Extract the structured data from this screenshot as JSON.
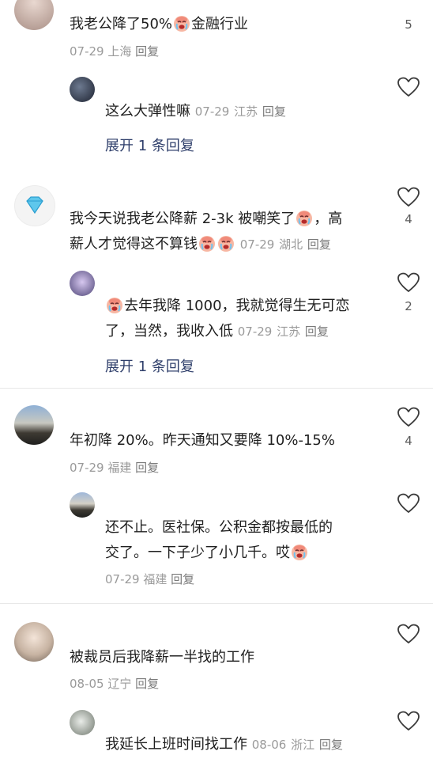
{
  "comments": [
    {
      "text": "我老公降了50%",
      "text_after_emoji": "金融行业",
      "date": "07-29",
      "location": "上海",
      "reply_label": "回复",
      "likes": "5",
      "reply": {
        "text": "这么大弹性嘛",
        "date": "07-29",
        "location": "江苏",
        "reply_label": "回复"
      },
      "expand_label": "展开 1 条回复"
    },
    {
      "text_line1": "我今天说我老公降薪 2-3k 被嘲笑了",
      "text_line1_end": "，高",
      "text_line2": "薪人才觉得这不算钱",
      "date": "07-29",
      "location": "湖北",
      "reply_label": "回复",
      "likes": "4",
      "reply": {
        "line1": "去年我降 1000，我就觉得生无可恋",
        "line2": "了，当然，我收入低",
        "date": "07-29",
        "location": "江苏",
        "reply_label": "回复",
        "likes": "2"
      },
      "expand_label": "展开 1 条回复"
    },
    {
      "text": "年初降 20%。昨天通知又要降 10%-15%",
      "date": "07-29",
      "location": "福建",
      "reply_label": "回复",
      "likes": "4",
      "reply": {
        "line1": "还不止。医社保。公积金都按最低的",
        "line2": "交了。一下子少了小几千。哎",
        "date": "07-29",
        "location": "福建",
        "reply_label": "回复"
      }
    },
    {
      "text": "被裁员后我降薪一半找的工作",
      "date": "08-05",
      "location": "辽宁",
      "reply_label": "回复",
      "reply": {
        "text": "我延长上班时间找工作",
        "date": "08-06",
        "location": "浙江",
        "reply_label": "回复"
      }
    }
  ],
  "icons": {
    "heart": "heart-outline-icon",
    "emoji": "crying-face-emoji",
    "diamond": "diamond-avatar-icon"
  },
  "colors": {
    "expand_link": "#2f3f6b",
    "meta": "#9a9a9a",
    "text": "#1f1f1f"
  }
}
